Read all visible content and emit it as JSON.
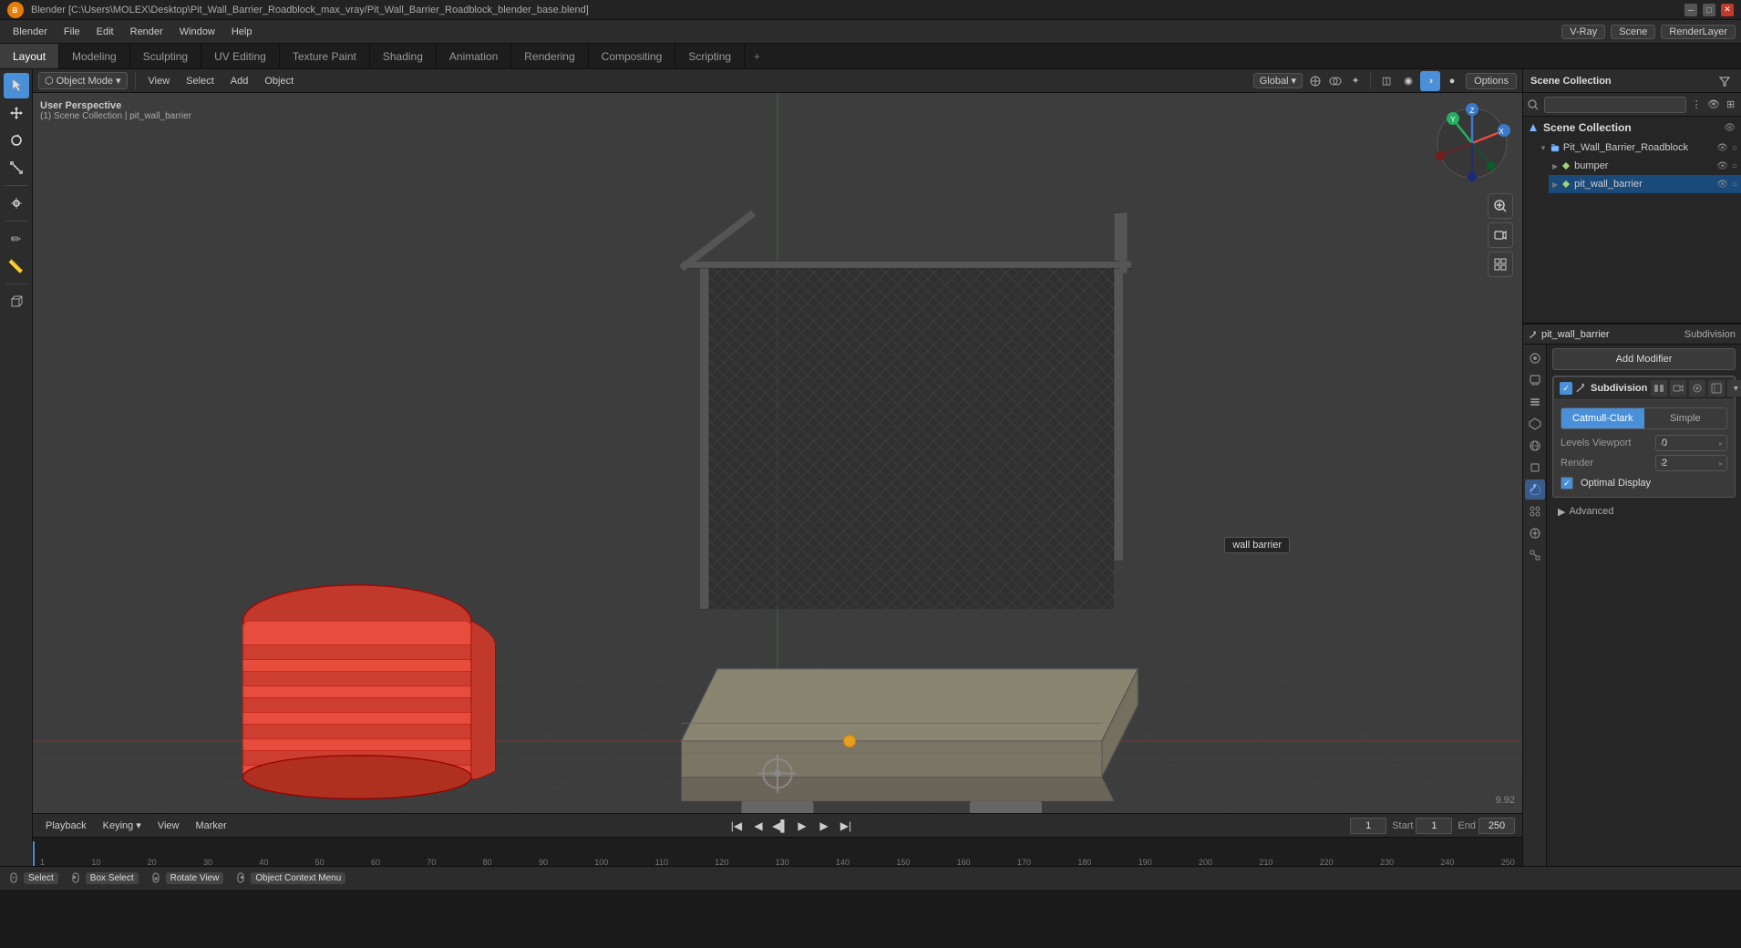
{
  "titleBar": {
    "title": "Blender  [C:\\Users\\MOLEX\\Desktop\\Pit_Wall_Barrier_Roadblock_max_vray/Pit_Wall_Barrier_Roadblock_blender_base.blend]",
    "logoText": "B"
  },
  "menuBar": {
    "items": [
      "Blender",
      "File",
      "Edit",
      "Render",
      "Window",
      "Help"
    ]
  },
  "workspaceTabs": {
    "tabs": [
      "Layout",
      "Modeling",
      "Sculpting",
      "UV Editing",
      "Texture Paint",
      "Shading",
      "Animation",
      "Rendering",
      "Compositing",
      "Scripting",
      "+"
    ],
    "active": "Layout"
  },
  "viewportHeader": {
    "mode": "Object Mode",
    "view": "View",
    "select": "Select",
    "add": "Add",
    "object": "Object",
    "globalMode": "Global",
    "options": "Options"
  },
  "sceneInfo": {
    "perspective": "User Perspective",
    "collection": "(1) Scene Collection | pit_wall_barrier"
  },
  "outliner": {
    "header": "Scene Collection",
    "items": [
      {
        "name": "Pit_Wall_Barrier_Roadblock",
        "type": "collection",
        "indent": 0,
        "expanded": true
      },
      {
        "name": "bumper",
        "type": "mesh",
        "indent": 1,
        "expanded": false
      },
      {
        "name": "pit_wall_barrier",
        "type": "mesh",
        "indent": 1,
        "expanded": false,
        "selected": true
      }
    ]
  },
  "rightPanelHeader": {
    "label": "pit_wall_barrier",
    "modifierLabel": "Subdivision"
  },
  "modifier": {
    "addLabel": "Add Modifier",
    "name": "Subdivision",
    "tabs": [
      "Catmull-Clark",
      "Simple"
    ],
    "activeTab": "Catmull-Clark",
    "levelsViewportLabel": "Levels Viewport",
    "levelsViewportValue": "0",
    "renderLabel": "Render",
    "renderValue": "2",
    "optimalDisplay": "Optimal Display",
    "optimalDisplayChecked": true,
    "advancedLabel": "Advanced"
  },
  "timeline": {
    "playbackLabel": "Playback",
    "keyingLabel": "Keying",
    "viewLabel": "View",
    "markerLabel": "Marker",
    "frameStart": "1",
    "frameEnd": "250",
    "startLabel": "Start",
    "endLabel": "End",
    "startValue": "1",
    "endValue": "250",
    "currentFrame": "1"
  },
  "statusBar": {
    "items": [
      {
        "key": "Select",
        "icon": "mouse-left",
        "desc": ""
      },
      {
        "key": "Box Select",
        "icon": "b-key",
        "desc": ""
      },
      {
        "key": "Rotate View",
        "icon": "middle-mouse",
        "desc": ""
      },
      {
        "key": "Object Context Menu",
        "icon": "right-click",
        "desc": ""
      }
    ]
  },
  "topRight": {
    "scene": "Scene",
    "renderLayer": "RenderLayer"
  },
  "viewport": {
    "zoomLevel": "9.92",
    "wallBarrierLabel": "wall barrier"
  },
  "frameNumbers": [
    "1",
    "10",
    "20",
    "30",
    "40",
    "50",
    "60",
    "70",
    "80",
    "90",
    "100",
    "110",
    "120",
    "130",
    "140",
    "150",
    "160",
    "170",
    "180",
    "190",
    "200",
    "210",
    "220",
    "230",
    "240",
    "250"
  ],
  "colors": {
    "accent": "#4a90d9",
    "background3d": "#3d3d3d",
    "panelBg": "#262626",
    "headerBg": "#2c2c2c",
    "activeMod": "#1a4a7a",
    "selectedItem": "#1a4a7a"
  }
}
